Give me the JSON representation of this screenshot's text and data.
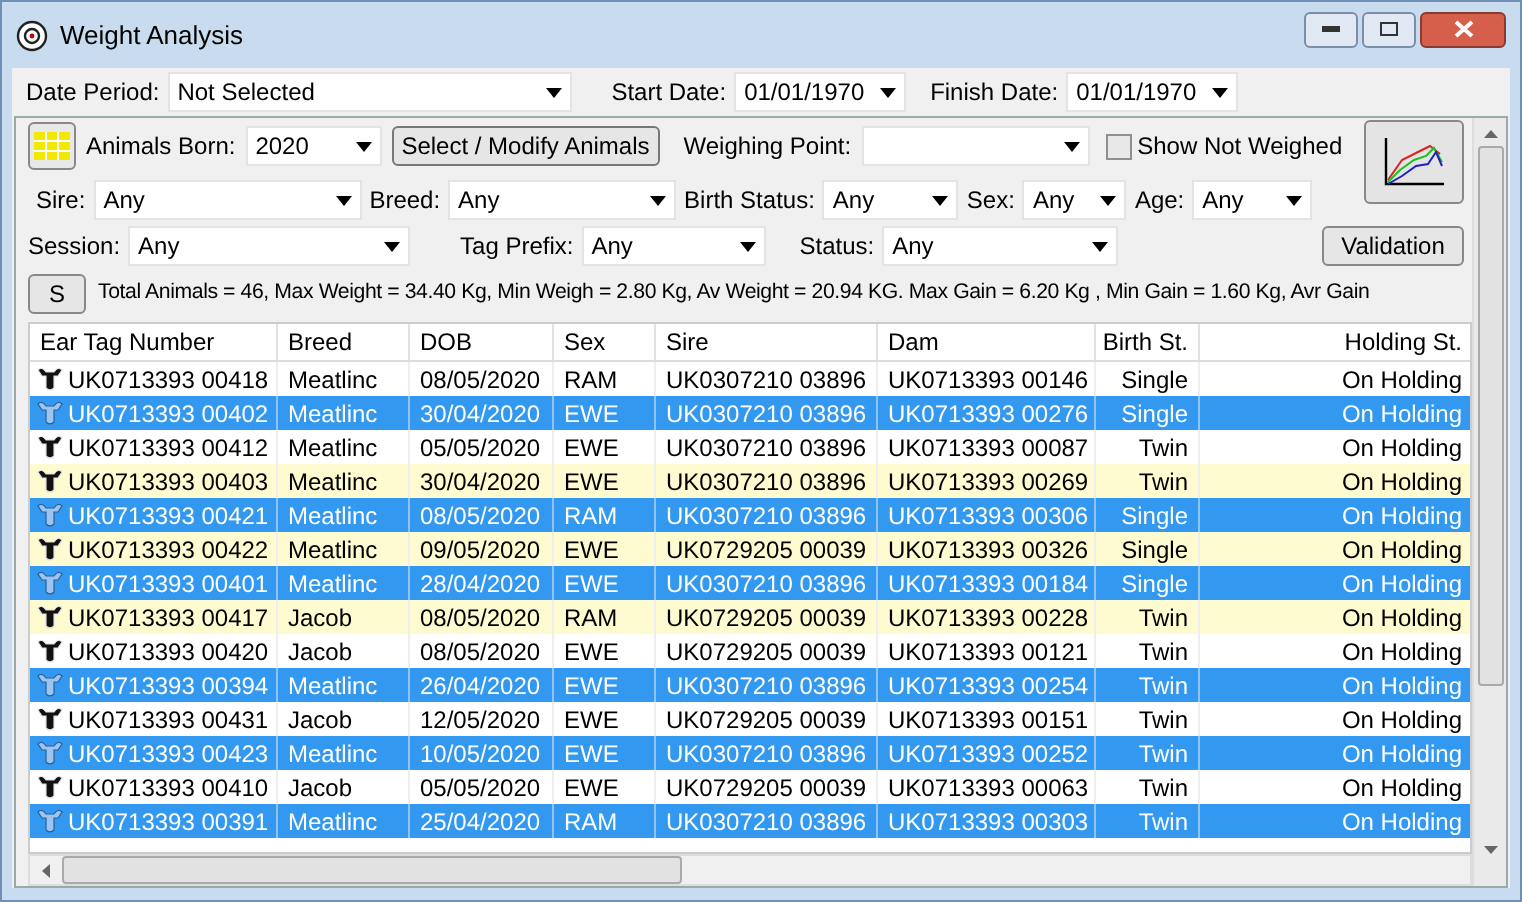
{
  "window": {
    "title": "Weight Analysis"
  },
  "date_bar": {
    "date_period": {
      "label": "Date Period:",
      "value": "Not Selected"
    },
    "start_date": {
      "label": "Start Date:",
      "value": "01/01/1970"
    },
    "finish_date": {
      "label": "Finish Date:",
      "value": "01/01/1970"
    }
  },
  "filters": {
    "animals_born": {
      "label": "Animals Born:",
      "value": "2020"
    },
    "select_button": "Select / Modify Animals",
    "weighing_point": {
      "label": "Weighing Point:"
    },
    "show_not_weighed": {
      "label": "Show Not Weighed",
      "checked": false
    },
    "sire": {
      "label": "Sire:",
      "value": "Any"
    },
    "breed": {
      "label": "Breed:",
      "value": "Any"
    },
    "birth_status": {
      "label": "Birth Status:",
      "value": "Any"
    },
    "sex": {
      "label": "Sex:",
      "value": "Any"
    },
    "age": {
      "label": "Age:",
      "value": "Any"
    },
    "session": {
      "label": "Session:",
      "value": "Any"
    },
    "tag_prefix": {
      "label": "Tag Prefix:",
      "value": "Any"
    },
    "status": {
      "label": "Status:",
      "value": "Any"
    },
    "validation_button": "Validation"
  },
  "summary": {
    "button": "S",
    "text": "Total Animals = 46, Max Weight = 34.40 Kg, Min Weigh = 2.80 Kg, Av Weight = 20.94 KG. Max Gain = 6.20 Kg , Min Gain = 1.60 Kg, Avr Gain"
  },
  "table": {
    "columns": [
      "Ear Tag Number",
      "Breed",
      "DOB",
      "Sex",
      "Sire",
      "Dam",
      "Birth St.",
      "Holding St."
    ],
    "rows": [
      {
        "cells": [
          "UK0713393 00418",
          "Meatlinc",
          "08/05/2020",
          "RAM",
          "UK0307210 03896",
          "UK0713393 00146",
          "Single",
          "On Holding"
        ],
        "selected": false,
        "highlighted": false
      },
      {
        "cells": [
          "UK0713393 00402",
          "Meatlinc",
          "30/04/2020",
          "EWE",
          "UK0307210 03896",
          "UK0713393 00276",
          "Single",
          "On Holding"
        ],
        "selected": true,
        "highlighted": false
      },
      {
        "cells": [
          "UK0713393 00412",
          "Meatlinc",
          "05/05/2020",
          "EWE",
          "UK0307210 03896",
          "UK0713393 00087",
          "Twin",
          "On Holding"
        ],
        "selected": false,
        "highlighted": false
      },
      {
        "cells": [
          "UK0713393 00403",
          "Meatlinc",
          "30/04/2020",
          "EWE",
          "UK0307210 03896",
          "UK0713393 00269",
          "Twin",
          "On Holding"
        ],
        "selected": false,
        "highlighted": true
      },
      {
        "cells": [
          "UK0713393 00421",
          "Meatlinc",
          "08/05/2020",
          "RAM",
          "UK0307210 03896",
          "UK0713393 00306",
          "Single",
          "On Holding"
        ],
        "selected": true,
        "highlighted": false
      },
      {
        "cells": [
          "UK0713393 00422",
          "Meatlinc",
          "09/05/2020",
          "EWE",
          "UK0729205 00039",
          "UK0713393 00326",
          "Single",
          "On Holding"
        ],
        "selected": false,
        "highlighted": true
      },
      {
        "cells": [
          "UK0713393 00401",
          "Meatlinc",
          "28/04/2020",
          "EWE",
          "UK0307210 03896",
          "UK0713393 00184",
          "Single",
          "On Holding"
        ],
        "selected": true,
        "highlighted": false
      },
      {
        "cells": [
          "UK0713393 00417",
          "Jacob",
          "08/05/2020",
          "RAM",
          "UK0729205 00039",
          "UK0713393 00228",
          "Twin",
          "On Holding"
        ],
        "selected": false,
        "highlighted": true
      },
      {
        "cells": [
          "UK0713393 00420",
          "Jacob",
          "08/05/2020",
          "EWE",
          "UK0729205 00039",
          "UK0713393 00121",
          "Twin",
          "On Holding"
        ],
        "selected": false,
        "highlighted": false
      },
      {
        "cells": [
          "UK0713393 00394",
          "Meatlinc",
          "26/04/2020",
          "EWE",
          "UK0307210 03896",
          "UK0713393 00254",
          "Twin",
          "On Holding"
        ],
        "selected": true,
        "highlighted": false
      },
      {
        "cells": [
          "UK0713393 00431",
          "Jacob",
          "12/05/2020",
          "EWE",
          "UK0729205 00039",
          "UK0713393 00151",
          "Twin",
          "On Holding"
        ],
        "selected": false,
        "highlighted": false
      },
      {
        "cells": [
          "UK0713393 00423",
          "Meatlinc",
          "10/05/2020",
          "EWE",
          "UK0307210 03896",
          "UK0713393 00252",
          "Twin",
          "On Holding"
        ],
        "selected": true,
        "highlighted": false
      },
      {
        "cells": [
          "UK0713393 00410",
          "Jacob",
          "05/05/2020",
          "EWE",
          "UK0729205 00039",
          "UK0713393 00063",
          "Twin",
          "On Holding"
        ],
        "selected": false,
        "highlighted": false
      },
      {
        "cells": [
          "UK0713393 00391",
          "Meatlinc",
          "25/04/2020",
          "RAM",
          "UK0307210 03896",
          "UK0713393 00303",
          "Twin",
          "On Holding"
        ],
        "selected": true,
        "highlighted": false
      }
    ]
  }
}
